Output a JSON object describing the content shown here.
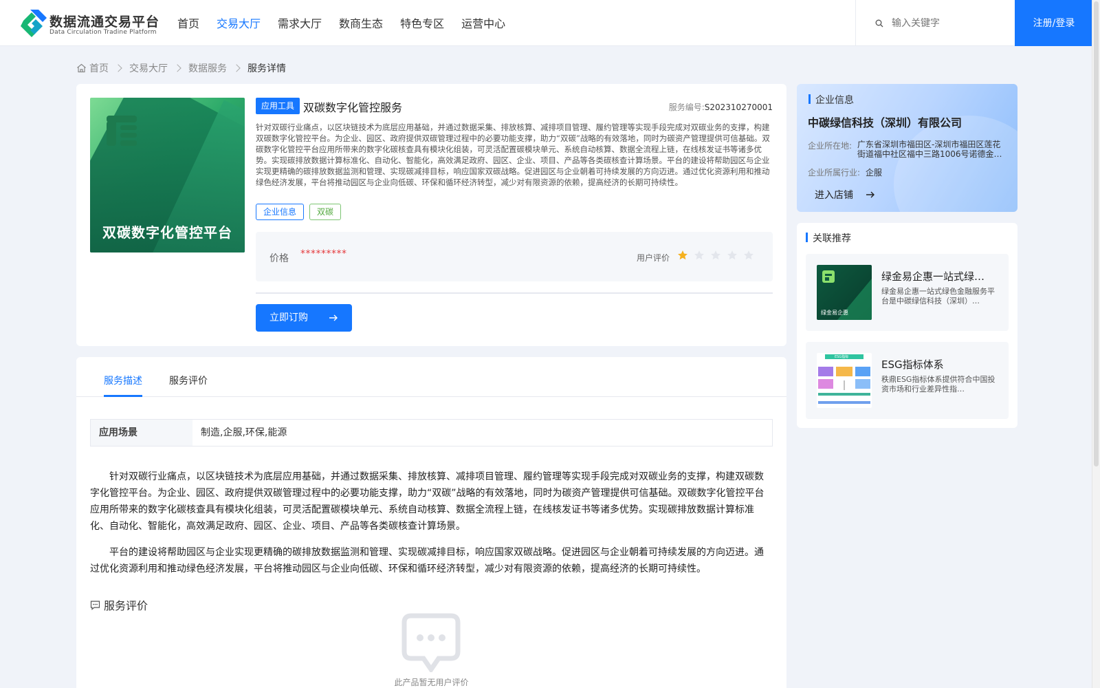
{
  "header": {
    "logo_title": "数据流通交易平台",
    "logo_subtitle": "Data Circulation Tradine Platform",
    "nav": [
      {
        "label": "首页"
      },
      {
        "label": "交易大厅",
        "active": true
      },
      {
        "label": "需求大厅"
      },
      {
        "label": "数商生态"
      },
      {
        "label": "特色专区"
      },
      {
        "label": "运营中心"
      }
    ],
    "search_placeholder": "输入关键字",
    "login_label": "注册/登录"
  },
  "breadcrumb": [
    "首页",
    "交易大厅",
    "数据服务",
    "服务详情"
  ],
  "product": {
    "cover_title": "双碳数字化管控平台",
    "category_tag": "应用工具",
    "title": "双碳数字化管控服务",
    "service_no_label": "服务编号:",
    "service_no": "S202310270001",
    "description": "针对双碳行业痛点，以区块链技术为底层应用基础，并通过数据采集、排放核算、减排项目管理、履约管理等实现手段完成对双碳业务的支撑，构建双碳数字化管控平台。为企业、园区、政府提供双碳管理过程中的必要功能支撑，助力“双碳”战略的有效落地，同时为碳资产管理提供可信基础。双碳数字化管控平台应用所带来的数字化碳核查具有模块化组装，可灵活配置碳模块单元、系统自动核算、数据全流程上链，在线核发证书等诸多优势。实现碳排放数据计算标准化、自动化、智能化，高效满足政府、园区、企业、项目、产品等各类碳核查计算场景。平台的建设将帮助园区与企业实现更精确的碳排放数据监测和管理、实现碳减排目标，响应国家双碳战略。促进园区与企业朝着可持续发展的方向迈进。通过优化资源利用和推动绿色经济发展，平台将推动园区与企业向低碳、环保和循环经济转型，减少对有限资源的依赖，提高经济的长期可持续性。",
    "tags": [
      "企业信息",
      "双碳"
    ],
    "price_label": "价格",
    "price_value": "*********",
    "rating_label": "用户评价",
    "rating": 1,
    "rating_max": 5,
    "buy_label": "立即订购"
  },
  "enterprise": {
    "section_title": "企业信息",
    "name": "中碳绿信科技（深圳）有限公司",
    "location_label": "企业所在地:",
    "location": "广东省深圳市福田区-深圳市福田区莲花街道福中社区福中三路1006号诺德金…",
    "industry_label": "企业所属行业:",
    "industry": "企服",
    "enter_shop_label": "进入店铺"
  },
  "related": {
    "section_title": "关联推荐",
    "items": [
      {
        "title": "绿金易企惠一站式绿…",
        "desc": "绿金易企惠一站式绿色金融服务平台是中碳绿信科技（深圳）…",
        "thumb_caption": "绿金易企惠"
      },
      {
        "title": "ESG指标体系",
        "desc": "秩鼎ESG指标体系提供符合中国投资市场和行业差异性指…",
        "thumb_caption": "ESG指标"
      }
    ]
  },
  "details": {
    "tabs": [
      {
        "label": "服务描述",
        "active": true
      },
      {
        "label": "服务评价"
      }
    ],
    "scene_label": "应用场景",
    "scene_value": "制造,企服,环保,能源",
    "paragraphs": [
      "针对双碳行业痛点，以区块链技术为底层应用基础，并通过数据采集、排放核算、减排项目管理、履约管理等实现手段完成对双碳业务的支撑，构建双碳数字化管控平台。为企业、园区、政府提供双碳管理过程中的必要功能支撑，助力“双碳”战略的有效落地，同时为碳资产管理提供可信基础。双碳数字化管控平台应用所带来的数字化碳核查具有模块化组装，可灵活配置碳模块单元、系统自动核算、数据全流程上链，在线核发证书等诸多优势。实现碳排放数据计算标准化、自动化、智能化，高效满足政府、园区、企业、项目、产品等各类碳核查计算场景。",
      "平台的建设将帮助园区与企业实现更精确的碳排放数据监测和管理、实现碳减排目标，响应国家双碳战略。促进园区与企业朝着可持续发展的方向迈进。通过优化资源利用和推动绿色经济发展，平台将推动园区与企业向低碳、环保和循环经济转型，减少对有限资源的依赖，提高经济的长期可持续性。"
    ],
    "review_title": "服务评价",
    "empty_text": "此产品暂无用户评价"
  },
  "colors": {
    "accent": "#1677ff",
    "price": "#e4393c",
    "star_on": "#f5b11f",
    "star_off": "#e3e6ec"
  }
}
